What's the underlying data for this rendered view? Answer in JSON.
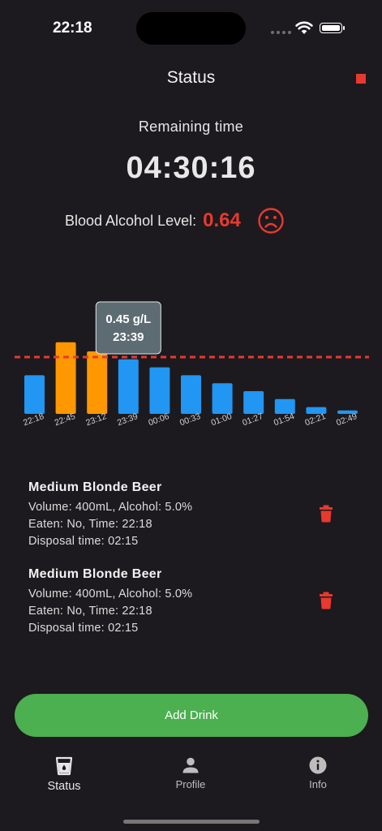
{
  "status_bar": {
    "time": "22:18"
  },
  "header": {
    "title": "Status"
  },
  "remaining": {
    "label": "Remaining time",
    "value": "04:30:16"
  },
  "bac": {
    "label": "Blood Alcohol Level:",
    "value": "0.64",
    "mood_icon": "sad-face-icon"
  },
  "colors": {
    "bar_normal": "#2196f3",
    "bar_highlight": "#ff9800",
    "limit_line": "#e8392f",
    "accent_red": "#e8392f",
    "add_button": "#4caf50"
  },
  "chart_data": {
    "type": "bar",
    "categories": [
      "22:18",
      "22:45",
      "23:12",
      "23:39",
      "00:06",
      "00:33",
      "01:00",
      "01:27",
      "01:54",
      "02:21",
      "02:49"
    ],
    "values": [
      0.34,
      0.63,
      0.55,
      0.48,
      0.41,
      0.34,
      0.27,
      0.2,
      0.13,
      0.06,
      0.03
    ],
    "highlighted": [
      "22:45",
      "23:12"
    ],
    "limit": 0.5,
    "ylim": [
      0,
      0.75
    ],
    "tooltip": {
      "value": "0.45 g/L",
      "time": "23:39"
    }
  },
  "drinks": [
    {
      "name": "Medium Blonde Beer",
      "details": "Volume: 400mL, Alcohol: 5.0%",
      "eaten": "Eaten: No, Time: 22:18",
      "disposal": "Disposal time: 02:15"
    },
    {
      "name": "Medium Blonde Beer",
      "details": "Volume: 400mL, Alcohol: 5.0%",
      "eaten": "Eaten: No, Time: 22:18",
      "disposal": "Disposal time: 02:15"
    }
  ],
  "add_button": {
    "label": "Add Drink"
  },
  "nav": [
    {
      "label": "Status",
      "icon": "drink-glass-icon",
      "active": true
    },
    {
      "label": "Profile",
      "icon": "person-icon",
      "active": false
    },
    {
      "label": "Info",
      "icon": "info-icon",
      "active": false
    }
  ]
}
